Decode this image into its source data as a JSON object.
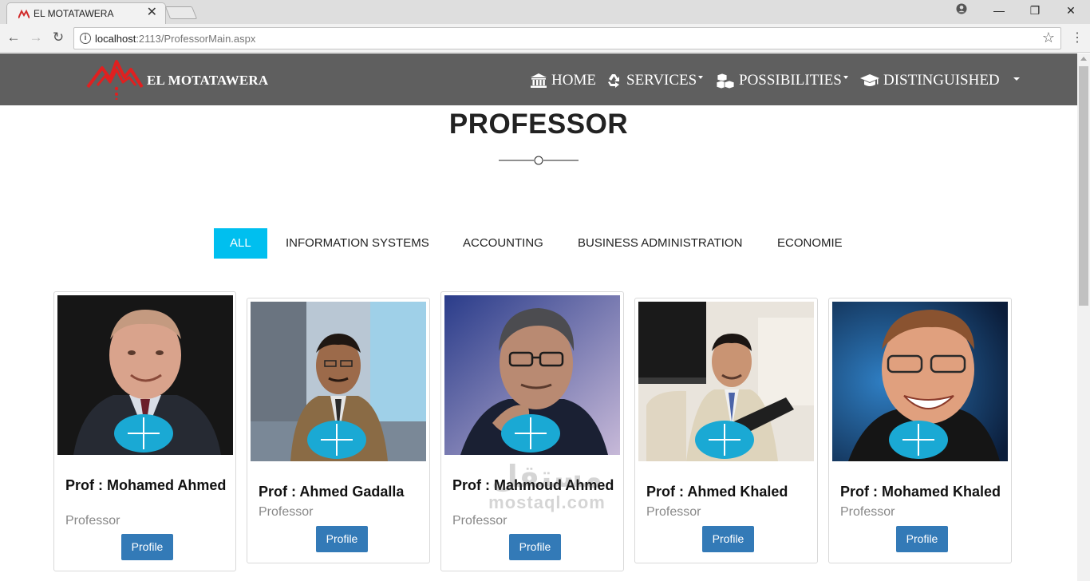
{
  "browser": {
    "tab_title": "EL MOTATAWERA",
    "tab_close": "✕",
    "url_host": "localhost",
    "url_rest": ":2113/ProfessorMain.aspx",
    "controls": {
      "minimize": "—",
      "restore": "❐",
      "close": "✕"
    }
  },
  "navbar": {
    "brand": "EL MOTATAWERA",
    "items": [
      {
        "label": "HOME",
        "icon": "bank-icon",
        "dropdown": false
      },
      {
        "label": "SERVICES",
        "icon": "recycle-icon",
        "dropdown": true
      },
      {
        "label": "POSSIBILITIES",
        "icon": "cubes-icon",
        "dropdown": true
      },
      {
        "label": "DISTINGUISHED",
        "icon": "graduation-cap-icon",
        "dropdown": false
      }
    ]
  },
  "page": {
    "title": "PROFESSOR"
  },
  "filters": [
    {
      "label": "ALL",
      "active": true
    },
    {
      "label": "INFORMATION SYSTEMS",
      "active": false
    },
    {
      "label": "ACCOUNTING",
      "active": false
    },
    {
      "label": "BUSINESS ADMINISTRATION",
      "active": false
    },
    {
      "label": "ECONOMIE",
      "active": false
    }
  ],
  "professors": [
    {
      "name": "Prof : Mohamed Ahmed",
      "role": "Professor",
      "button": "Profile"
    },
    {
      "name": "Prof : Ahmed Gadalla",
      "role": "Professor",
      "button": "Profile"
    },
    {
      "name": "Prof : Mahmoud Ahmed",
      "role": "Professor",
      "button": "Profile"
    },
    {
      "name": "Prof : Ahmed Khaled",
      "role": "Professor",
      "button": "Profile"
    },
    {
      "name": "Prof : Mohamed Khaled",
      "role": "Professor",
      "button": "Profile"
    }
  ],
  "watermark": {
    "arabic": "مستقل",
    "latin": "mostaql.com"
  },
  "colors": {
    "navbar": "#5f5f5f",
    "accent": "#00bfef",
    "button": "#337ab7",
    "plus": "#1aa9d4",
    "logo": "#e02020"
  }
}
